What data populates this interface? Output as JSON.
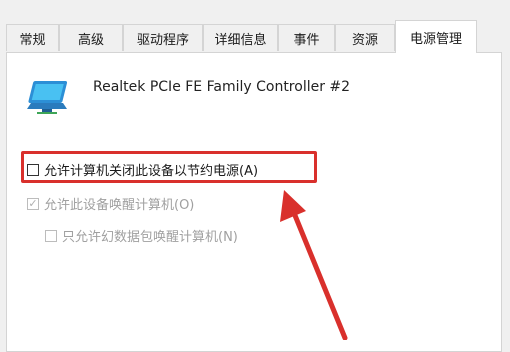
{
  "tabs": [
    {
      "label": "常规",
      "active": false
    },
    {
      "label": "高级",
      "active": false
    },
    {
      "label": "驱动程序",
      "active": false
    },
    {
      "label": "详细信息",
      "active": false
    },
    {
      "label": "事件",
      "active": false
    },
    {
      "label": "资源",
      "active": false
    },
    {
      "label": "电源管理",
      "active": true
    }
  ],
  "device": {
    "icon": "network-adapter-icon",
    "name": "Realtek PCIe FE Family Controller #2"
  },
  "options": [
    {
      "label": "允许计算机关闭此设备以节约电源(A)",
      "checked": false,
      "enabled": true,
      "highlighted": true
    },
    {
      "label": "允许此设备唤醒计算机(O)",
      "checked": true,
      "enabled": false
    },
    {
      "label": "只允许幻数据包唤醒计算机(N)",
      "checked": false,
      "enabled": false
    }
  ],
  "annotation_color": "#d9302c"
}
